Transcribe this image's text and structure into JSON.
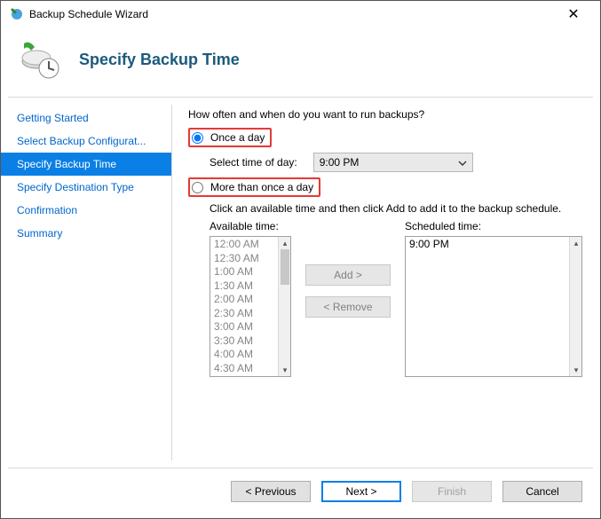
{
  "window": {
    "title": "Backup Schedule Wizard"
  },
  "header": {
    "title": "Specify Backup Time"
  },
  "sidebar": {
    "items": [
      {
        "label": "Getting Started"
      },
      {
        "label": "Select Backup Configurat..."
      },
      {
        "label": "Specify Backup Time"
      },
      {
        "label": "Specify Destination Type"
      },
      {
        "label": "Confirmation"
      },
      {
        "label": "Summary"
      }
    ],
    "selectedIndex": 2
  },
  "content": {
    "prompt": "How often and when do you want to run backups?",
    "radio_once": "Once a day",
    "radio_multi": "More than once a day",
    "time_label": "Select time of day:",
    "time_value": "9:00 PM",
    "instruction": "Click an available time and then click Add to add it to the backup schedule.",
    "available_label": "Available time:",
    "scheduled_label": "Scheduled time:",
    "available_items": [
      "12:00 AM",
      "12:30 AM",
      "1:00 AM",
      "1:30 AM",
      "2:00 AM",
      "2:30 AM",
      "3:00 AM",
      "3:30 AM",
      "4:00 AM",
      "4:30 AM"
    ],
    "scheduled_items": [
      "9:00 PM"
    ],
    "add_label": "Add >",
    "remove_label": "< Remove"
  },
  "footer": {
    "prev": "< Previous",
    "next": "Next >",
    "finish": "Finish",
    "cancel": "Cancel"
  }
}
